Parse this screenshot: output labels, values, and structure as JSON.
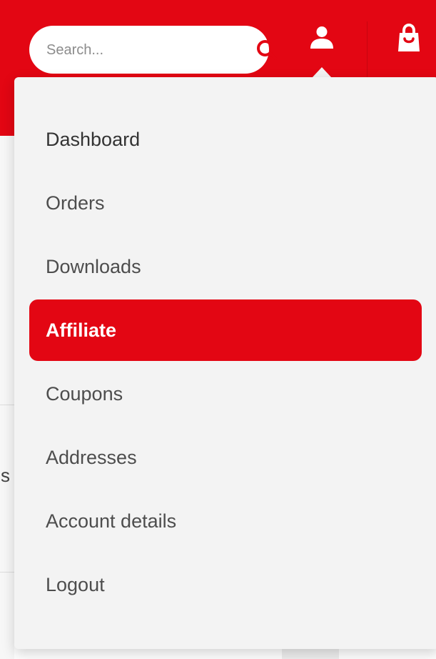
{
  "colors": {
    "brand_red": "#e30613",
    "menu_background": "#f3f3f3",
    "menu_text": "#4d4d4d",
    "active_text": "#ffffff"
  },
  "header": {
    "search": {
      "placeholder": "Search...",
      "value": "",
      "icon": "search-icon"
    },
    "account_icon": "user-icon",
    "cart_icon": "shopping-bag-icon"
  },
  "account_menu": {
    "items": [
      {
        "label": "Dashboard",
        "active": false
      },
      {
        "label": "Orders",
        "active": false
      },
      {
        "label": "Downloads",
        "active": false
      },
      {
        "label": "Affiliate",
        "active": true
      },
      {
        "label": "Coupons",
        "active": false
      },
      {
        "label": "Addresses",
        "active": false
      },
      {
        "label": "Account details",
        "active": false
      },
      {
        "label": "Logout",
        "active": false
      }
    ]
  },
  "background": {
    "left_edge_text": "s"
  }
}
